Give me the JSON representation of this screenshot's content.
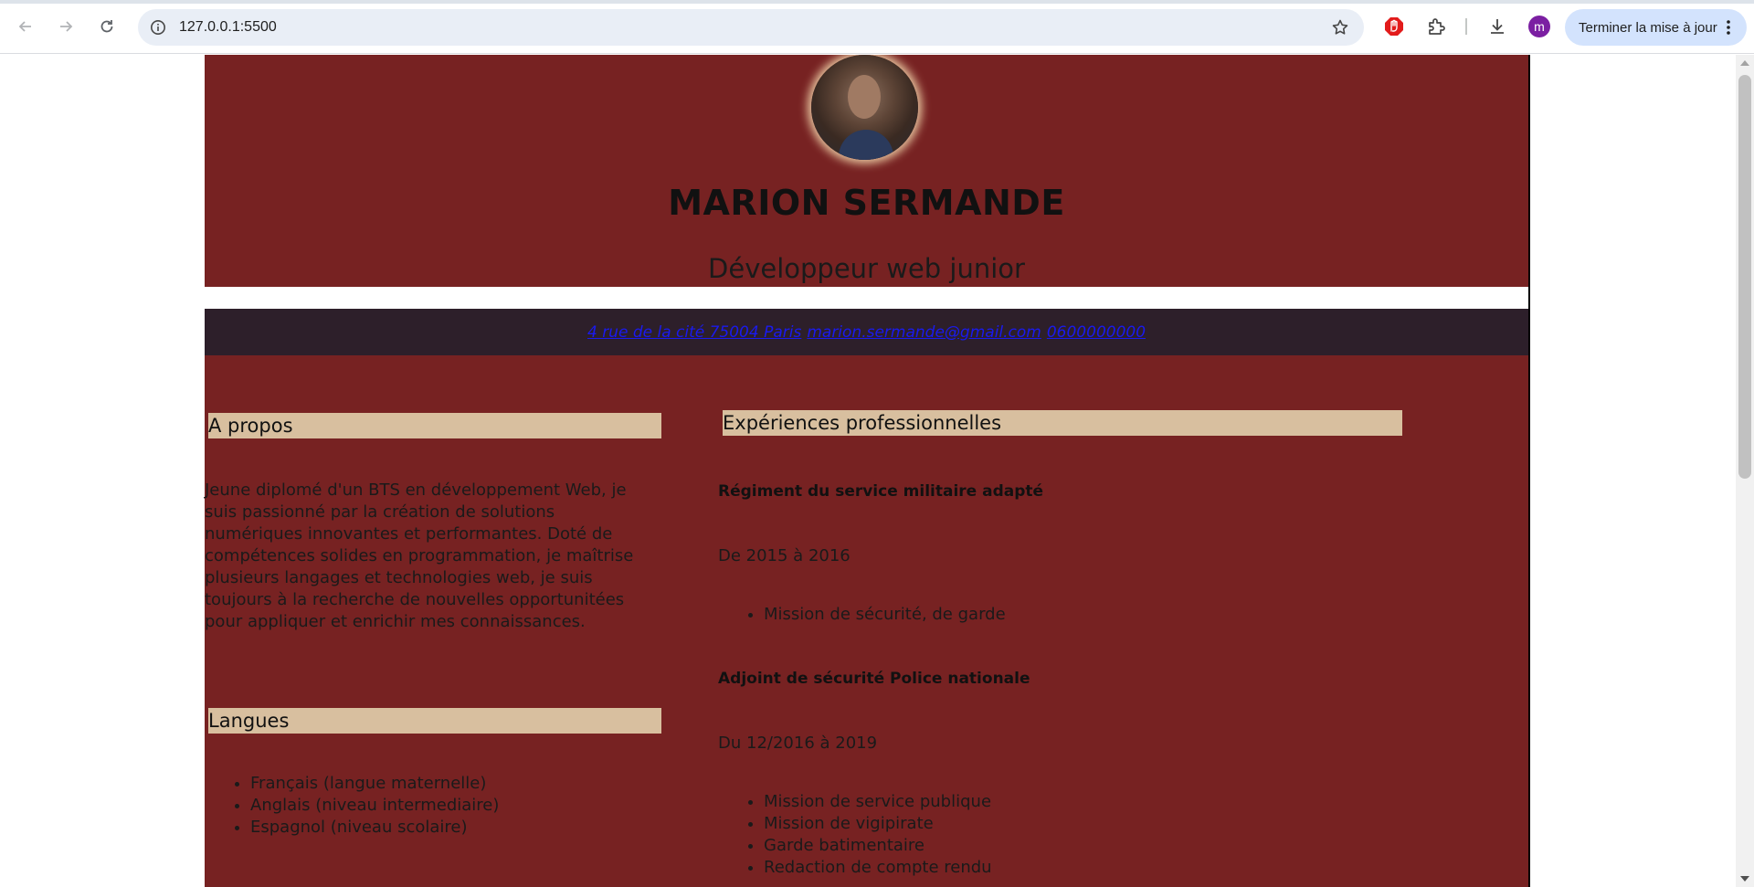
{
  "browser": {
    "url": "127.0.0.1:5500",
    "update_button_label": "Terminer la mise à jour",
    "profile_initial": "m",
    "icons": [
      "back-arrow-icon",
      "forward-arrow-icon",
      "reload-icon",
      "site-info-icon",
      "bookmark-star-icon",
      "adblock-icon",
      "extensions-icon",
      "download-icon",
      "more-vert-icon"
    ]
  },
  "header": {
    "name": "MARION SERMANDE",
    "job_title": "Développeur web junior"
  },
  "contact": {
    "address": "4 rue de la cité 75004 Paris",
    "email": "marion.sermande@gmail.com",
    "phone": "0600000000"
  },
  "about": {
    "title": "A propos",
    "text": "Jeune diplomé d'un BTS en développement Web, je suis passionné par la création de solutions numériques innovantes et performantes. Doté de compétences solides en programmation, je maîtrise plusieurs langages et technologies web, je suis toujours à la recherche de nouvelles opportunitées pour appliquer et enrichir mes connaissances."
  },
  "languages": {
    "title": "Langues",
    "items": [
      "Français (langue maternelle)",
      "Anglais (niveau intermediaire)",
      "Espagnol (niveau scolaire)"
    ]
  },
  "experiences": {
    "title": "Expériences professionnelles",
    "items": [
      {
        "title": "Régiment du service militaire adapté",
        "period": "De 2015 à 2016",
        "missions": [
          "Mission de sécurité, de garde"
        ]
      },
      {
        "title": "Adjoint de sécurité Police nationale",
        "period": "Du 12/2016 à 2019",
        "missions": [
          "Mission de service publique",
          "Mission de vigipirate",
          "Garde batimentaire",
          "Redaction de compte rendu"
        ]
      }
    ]
  },
  "colors": {
    "cv_background": "#772222",
    "contact_bar": "#2d1f2a",
    "section_title_background": "#d8bf9f",
    "link": "#1a1aee"
  }
}
